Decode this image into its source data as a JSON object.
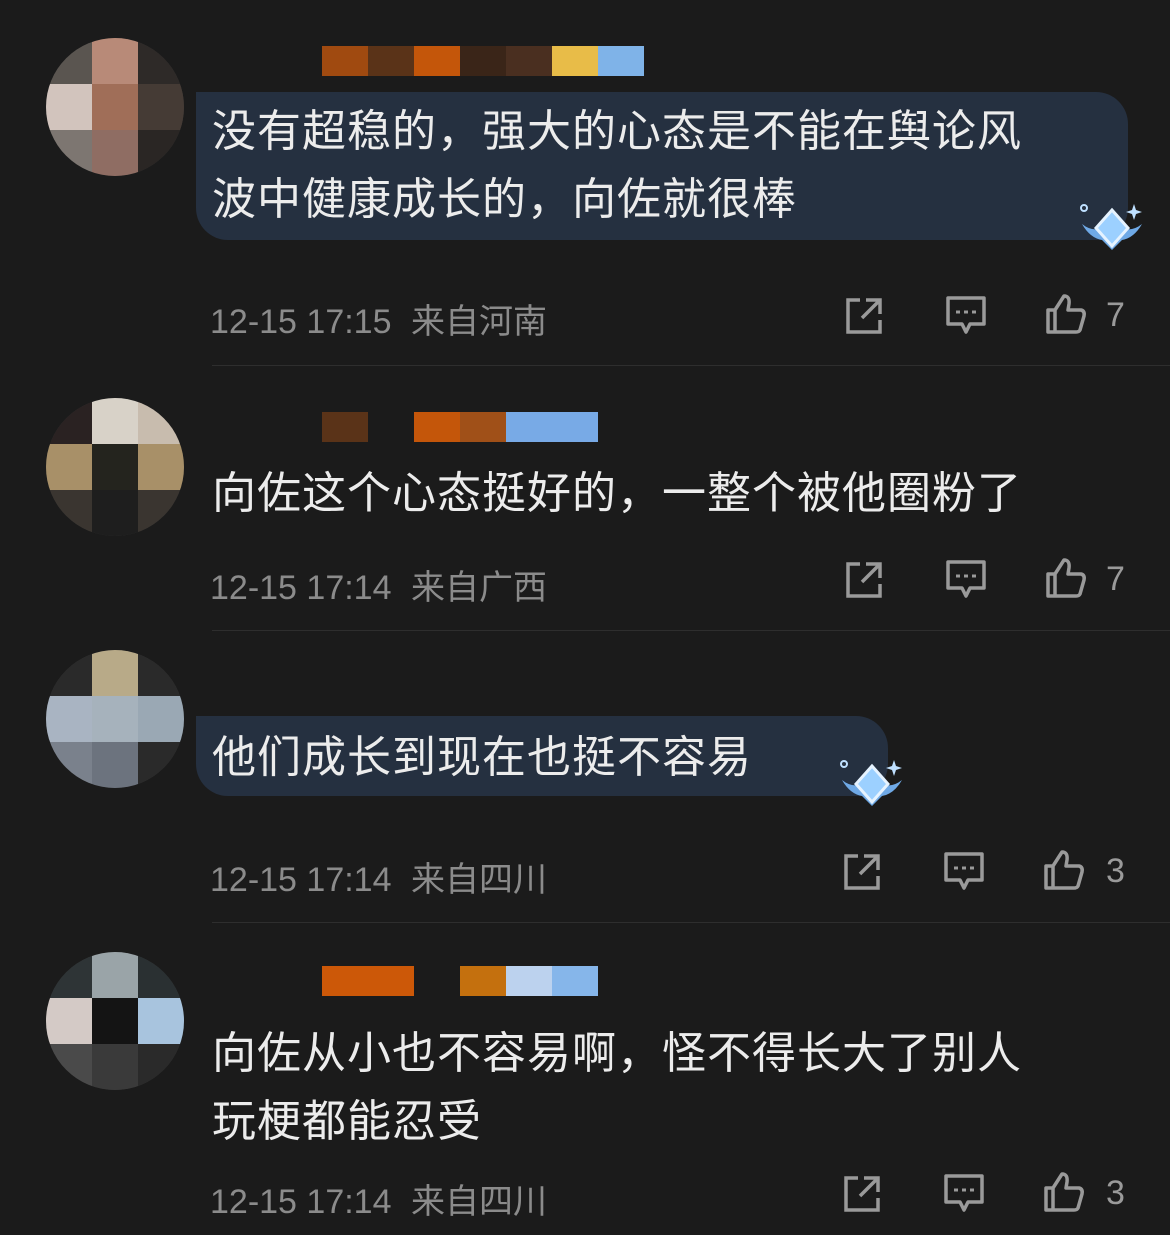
{
  "comments": [
    {
      "text": "没有超稳的，强大的心态是不能在舆论风\n波中健康成长的，向佐就很棒",
      "timestamp": "12-15 17:15",
      "location": "来自河南",
      "likes": "7",
      "has_badge": true
    },
    {
      "text": "向佐这个心态挺好的，一整个被他圈粉了",
      "timestamp": "12-15 17:14",
      "location": "来自广西",
      "likes": "7",
      "has_badge": false
    },
    {
      "text": "他们成长到现在也挺不容易",
      "timestamp": "12-15 17:14",
      "location": "来自四川",
      "likes": "3",
      "has_badge": true
    },
    {
      "text": "向佐从小也不容易啊，怪不得长大了别人\n玩梗都能忍受",
      "timestamp": "12-15 17:14",
      "location": "来自四川",
      "likes": "3",
      "has_badge": false
    }
  ],
  "icons": {
    "share": "share-icon",
    "reply": "comment-icon",
    "like": "thumbs-up-icon",
    "badge": "diamond-badge-icon"
  },
  "colors": {
    "background": "#1b1b1b",
    "bubble": "#253040",
    "meta_text": "#8b8b8b"
  }
}
